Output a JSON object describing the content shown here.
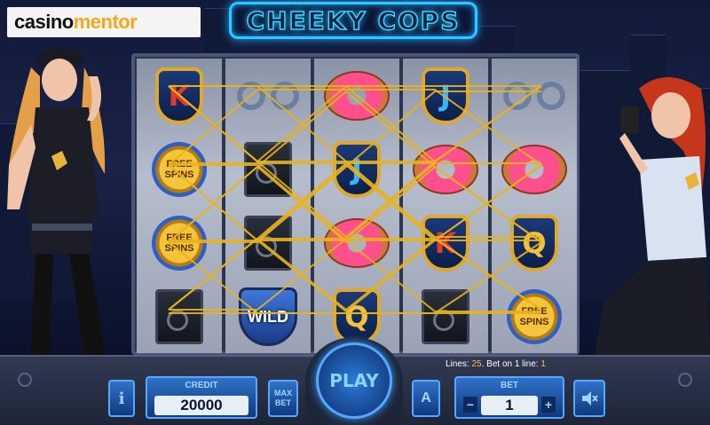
{
  "logo": {
    "part1": "casino",
    "part2": "mentor"
  },
  "title": "CHEEKY COPS",
  "reels": [
    [
      {
        "type": "badge",
        "label": "K",
        "variant": "k"
      },
      {
        "type": "free",
        "label": "FREE SPINS"
      },
      {
        "type": "free",
        "label": "FREE SPINS"
      },
      {
        "type": "safe",
        "label": ""
      }
    ],
    [
      {
        "type": "cuffs",
        "label": ""
      },
      {
        "type": "safe",
        "label": ""
      },
      {
        "type": "safe",
        "label": ""
      },
      {
        "type": "wild",
        "label": "WILD"
      }
    ],
    [
      {
        "type": "donut",
        "label": ""
      },
      {
        "type": "badge",
        "label": "J",
        "variant": "j"
      },
      {
        "type": "donut",
        "label": ""
      },
      {
        "type": "badge",
        "label": "Q",
        "variant": "q"
      }
    ],
    [
      {
        "type": "badge",
        "label": "J",
        "variant": "j"
      },
      {
        "type": "donut",
        "label": ""
      },
      {
        "type": "badge",
        "label": "K",
        "variant": "k"
      },
      {
        "type": "safe",
        "label": ""
      }
    ],
    [
      {
        "type": "cuffs",
        "label": ""
      },
      {
        "type": "donut",
        "label": ""
      },
      {
        "type": "badge",
        "label": "Q",
        "variant": "q"
      },
      {
        "type": "free",
        "label": "FREE SPINS"
      }
    ]
  ],
  "status": {
    "lines_label": "Lines:",
    "lines_value": "25",
    "bet_line_label": "Bet on 1 line:",
    "bet_line_value": "1"
  },
  "controls": {
    "info_label": "i",
    "credit_label": "CREDIT",
    "credit_value": "20000",
    "max_label": "MAX",
    "bet_word": "BET",
    "play_label": "PLAY",
    "auto_label": "A",
    "bet_label": "BET",
    "bet_value": "1",
    "minus": "−",
    "plus": "+",
    "sound_icon": "speaker-mute-icon"
  },
  "colors": {
    "accent": "#2ec7ff",
    "payline": "#e8b21c",
    "gold": "#f2c23a",
    "button": "#2f72c8"
  }
}
